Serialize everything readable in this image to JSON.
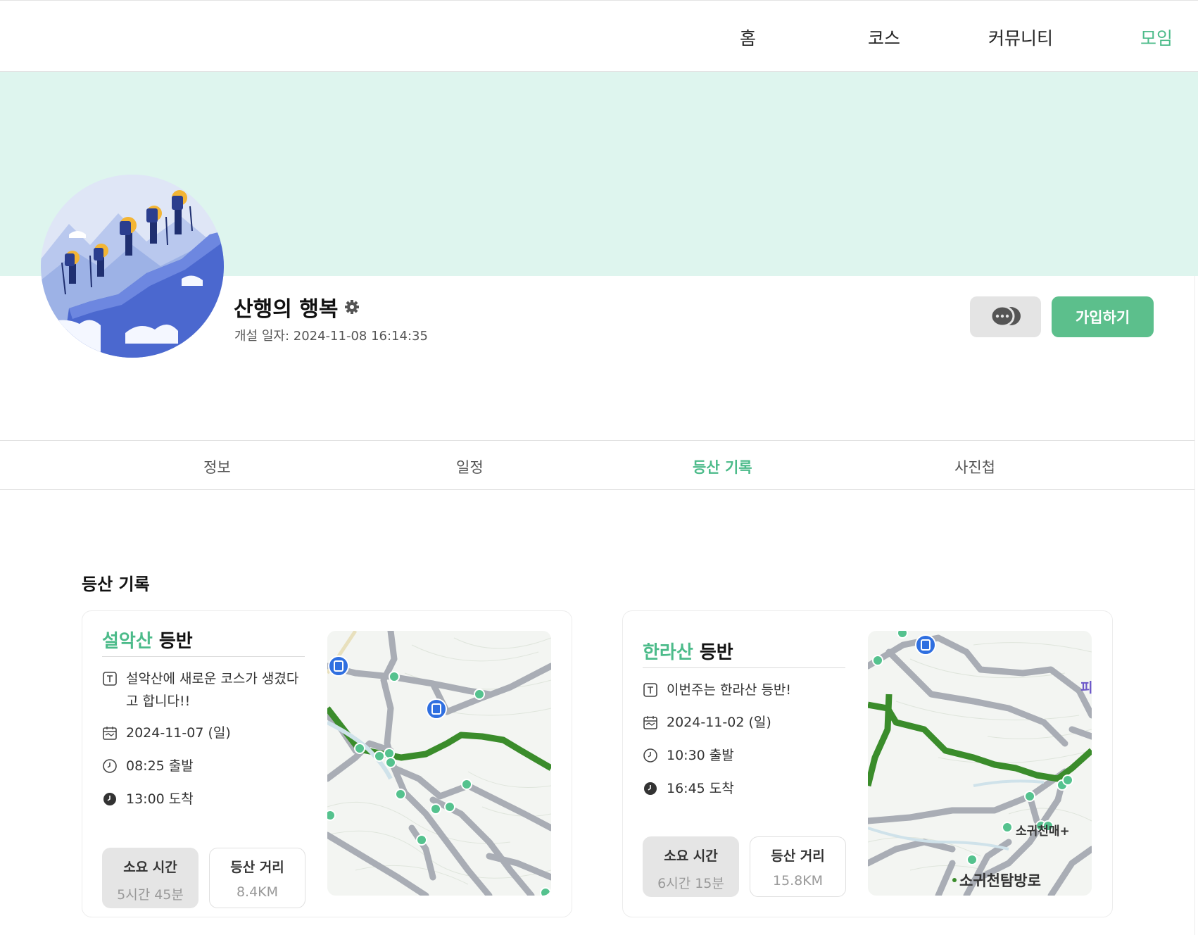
{
  "nav": {
    "items": [
      {
        "label": "홈",
        "active": false
      },
      {
        "label": "코스",
        "active": false
      },
      {
        "label": "커뮤니티",
        "active": false
      },
      {
        "label": "모임",
        "active": true
      }
    ]
  },
  "club": {
    "name": "산행의 행복",
    "created_label": "개설 일자: ",
    "created_at": "2024-11-08 16:14:35",
    "join_label": "가입하기",
    "chat_icon": "chat-bubbles-icon",
    "settings_icon": "gear-icon"
  },
  "tabs": [
    {
      "label": "정보",
      "active": false
    },
    {
      "label": "일정",
      "active": false
    },
    {
      "label": "등산 기록",
      "active": true
    },
    {
      "label": "사진첩",
      "active": false
    }
  ],
  "section": {
    "title": "등산 기록"
  },
  "records": [
    {
      "mountain": "설악산",
      "suffix": " 등반",
      "description": "설악산에 새로운 코스가 생겼다고 합니다!!",
      "date": "2024-11-07 (일)",
      "depart": "08:25 출발",
      "arrive": "13:00 도착",
      "duration_label": "소요 시간",
      "duration": "5시간 45분",
      "distance_label": "등산 거리",
      "distance": "8.4KM"
    },
    {
      "mountain": "한라산",
      "suffix": " 등반",
      "description": "이번주는 한라산 등반!",
      "date": "2024-11-02 (일)",
      "depart": "10:30 출발",
      "arrive": "16:45 도착",
      "duration_label": "소요 시간",
      "duration": "6시간 15분",
      "distance_label": "등산 거리",
      "distance": "15.8KM",
      "map_labels": [
        "소귀천매+",
        "소귀천탐방로",
        "피"
      ]
    }
  ],
  "colors": {
    "accent": "#4cbb8a",
    "banner": "#def5ee",
    "join": "#5cbf8c",
    "route": "#3f8f2f"
  }
}
